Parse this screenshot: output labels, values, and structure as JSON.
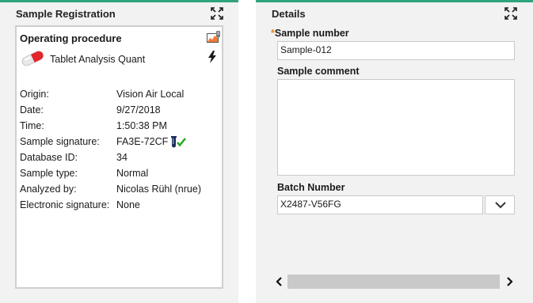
{
  "left_panel": {
    "title": "Sample Registration",
    "card": {
      "heading": "Operating procedure",
      "procedure_name": "Tablet Analysis Quant",
      "fields": [
        {
          "label": "Origin:",
          "value": "Vision Air Local"
        },
        {
          "label": "Date:",
          "value": "9/27/2018"
        },
        {
          "label": "Time:",
          "value": "1:50:38 PM"
        },
        {
          "label": "Sample signature:",
          "value": "FA3E-72CF"
        },
        {
          "label": "Database ID:",
          "value": "34"
        },
        {
          "label": "Sample type:",
          "value": "Normal"
        },
        {
          "label": "Analyzed by:",
          "value": "Nicolas Rühl (nrue)"
        },
        {
          "label": "Electronic signature:",
          "value": "None"
        }
      ]
    },
    "icons": [
      "expand-icon",
      "pill-icon",
      "chart-icon",
      "lightning-icon",
      "vial-icon",
      "checkmark-icon"
    ]
  },
  "right_panel": {
    "title": "Details",
    "sample_number": {
      "required_marker": "*",
      "label": "Sample number",
      "value": "Sample-012"
    },
    "sample_comment": {
      "label": "Sample comment",
      "value": ""
    },
    "batch_number": {
      "label": "Batch Number",
      "value": "X2487-V56FG"
    },
    "icons": [
      "expand-icon",
      "chevron-down-icon",
      "chevron-left-icon",
      "chevron-right-icon"
    ]
  },
  "colors": {
    "accent": "#2fa37e",
    "required": "#e08a1e",
    "check": "#1fa51f"
  }
}
